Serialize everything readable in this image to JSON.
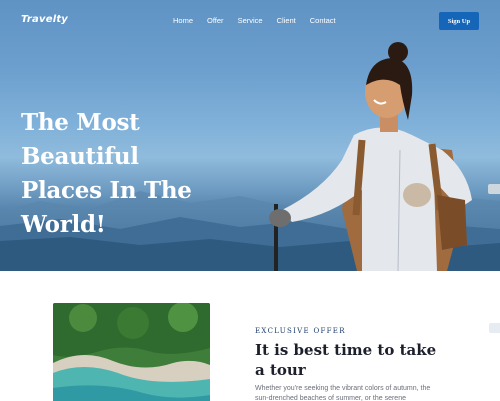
{
  "header": {
    "logo": "Travelty",
    "nav": [
      "Home",
      "Offer",
      "Service",
      "Client",
      "Contact"
    ],
    "signup_label": "Sign Up"
  },
  "hero": {
    "title_lines": [
      "The Most Beautiful",
      "Places In The",
      "World!"
    ]
  },
  "offer": {
    "eyebrow": "EXCLUSIVE OFFER",
    "title": "It is best time to take a tour",
    "text": "Whether you're seeking the vibrant colors of autumn, the sun-drenched beaches of summer, or the serene"
  },
  "colors": {
    "accent": "#1565b8",
    "heading": "#1d1f2c",
    "eyebrow": "#1b3a6b"
  },
  "icons": {
    "side_chip_top": "chat-icon",
    "side_chip_bottom": "cart-icon"
  }
}
